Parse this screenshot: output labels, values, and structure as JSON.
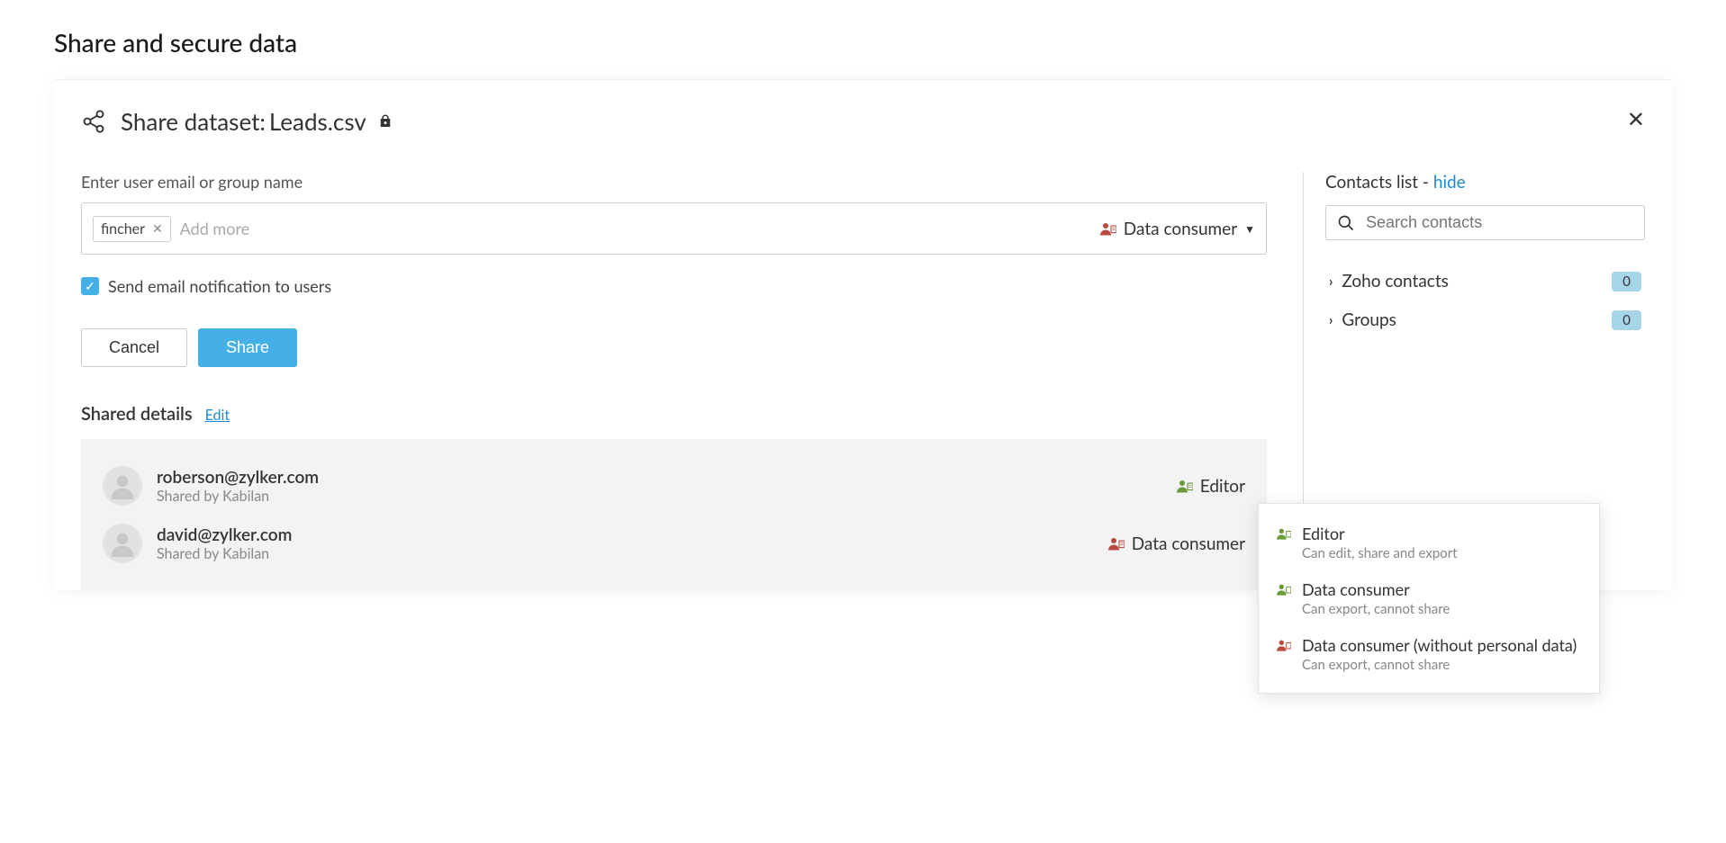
{
  "page": {
    "title": "Share and secure data"
  },
  "modal": {
    "title_prefix": "Share dataset: ",
    "dataset_name": "Leads.csv",
    "close": "✕"
  },
  "form": {
    "label": "Enter user email or group name",
    "chip": "fincher",
    "add_more": "Add more",
    "role_selected": "Data consumer",
    "notify_label": "Send email notification to users",
    "cancel": "Cancel",
    "share": "Share"
  },
  "shared": {
    "title": "Shared details",
    "edit": "Edit",
    "rows": [
      {
        "email": "roberson@zylker.com",
        "by": "Shared by Kabilan",
        "role": "Editor",
        "role_color": "green"
      },
      {
        "email": "david@zylker.com",
        "by": "Shared by Kabilan",
        "role": "Data consumer",
        "role_color": "red"
      }
    ]
  },
  "contacts": {
    "title_prefix": "Contacts list - ",
    "hide": "hide",
    "search_placeholder": "Search contacts",
    "groups": [
      {
        "label": "Zoho contacts",
        "count": "0"
      },
      {
        "label": "Groups",
        "count": "0"
      }
    ]
  },
  "dropdown": {
    "items": [
      {
        "title": "Editor",
        "desc": "Can edit, share and export",
        "color": "green"
      },
      {
        "title": "Data consumer",
        "desc": "Can export, cannot share",
        "color": "green"
      },
      {
        "title": "Data consumer (without personal data)",
        "desc": "Can export, cannot share",
        "color": "red"
      }
    ]
  }
}
